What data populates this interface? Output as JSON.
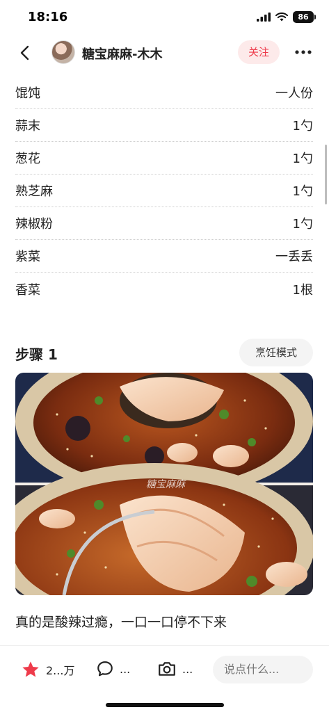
{
  "status_bar": {
    "time": "18:16",
    "battery": "86"
  },
  "header": {
    "author_name": "糖宝麻麻-木木",
    "follow_label": "关注"
  },
  "ingredients": [
    {
      "name": "馄饨",
      "qty": "一人份"
    },
    {
      "name": "蒜末",
      "qty": "1勺"
    },
    {
      "name": "葱花",
      "qty": "1勺"
    },
    {
      "name": "熟芝麻",
      "qty": "1勺"
    },
    {
      "name": "辣椒粉",
      "qty": "1勺"
    },
    {
      "name": "紫菜",
      "qty": "一丢丢"
    },
    {
      "name": "香菜",
      "qty": "1根"
    }
  ],
  "step": {
    "title": "步骤 1",
    "cook_mode_label": "烹饪模式",
    "image_watermark": "糖宝麻麻",
    "description": "真的是酸辣过瘾，一口一口停不下来"
  },
  "bottom_bar": {
    "like_count": "2...万",
    "comment_count": "...",
    "photo_count": "...",
    "comment_placeholder": "说点什么..."
  },
  "colors": {
    "accent": "#ee3b4b",
    "follow_bg": "#fdeaea",
    "star": "#ee3b4b"
  }
}
